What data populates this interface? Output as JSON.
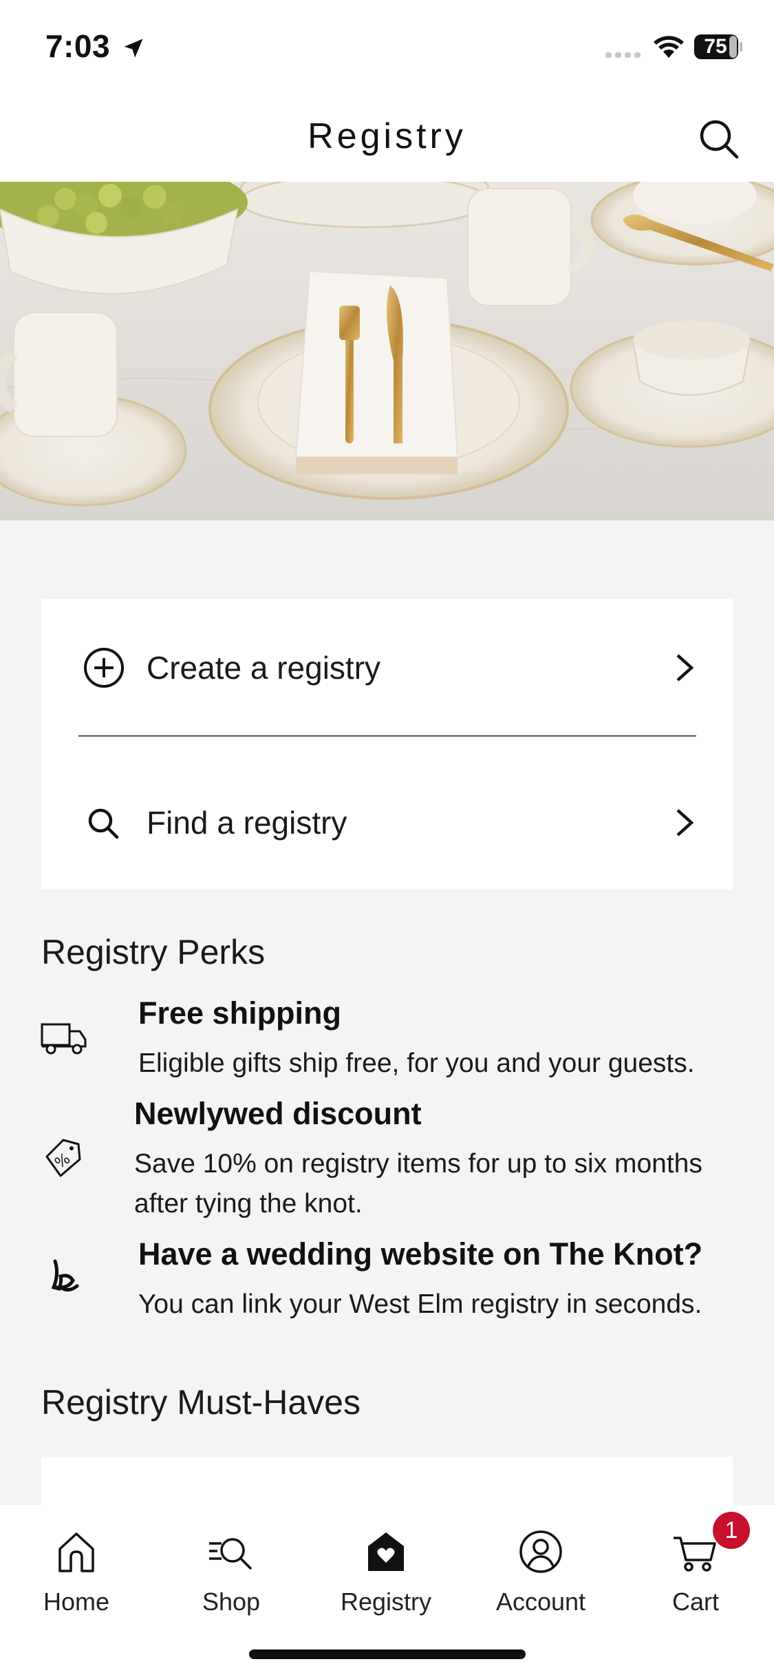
{
  "status_bar": {
    "time": "7:03",
    "battery": "75"
  },
  "header": {
    "title": "Registry"
  },
  "actions": {
    "create_label": "Create a registry",
    "find_label": "Find a registry"
  },
  "perks": {
    "title": "Registry Perks",
    "items": [
      {
        "icon": "truck-icon",
        "title": "Free shipping",
        "text": "Eligible gifts ship free, for you and your guests."
      },
      {
        "icon": "discount-tag-icon",
        "title": "Newlywed discount",
        "text": "Save 10% on registry items for up to six months after tying the knot."
      },
      {
        "icon": "the-knot-icon",
        "title": "Have a wedding website on The Knot?",
        "text": "You can link your West Elm registry in seconds."
      }
    ]
  },
  "must_haves": {
    "title": "Registry Must-Haves"
  },
  "tab_bar": {
    "items": [
      {
        "label": "Home",
        "icon": "home-icon"
      },
      {
        "label": "Shop",
        "icon": "shop-search-icon"
      },
      {
        "label": "Registry",
        "icon": "registry-heart-icon",
        "active": true
      },
      {
        "label": "Account",
        "icon": "account-icon"
      },
      {
        "label": "Cart",
        "icon": "cart-icon"
      }
    ],
    "cart_count": "1"
  },
  "colors": {
    "background": "#f4f4f4",
    "badge": "#c8102e",
    "text": "#111111"
  }
}
